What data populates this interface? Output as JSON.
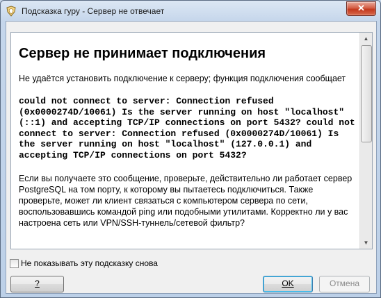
{
  "window": {
    "title": "Подсказка гуру - Сервер не отвечает",
    "close_label": "✕"
  },
  "content": {
    "heading": "Сервер не принимает подключения",
    "intro": "Не удаётся установить подключение к серверу; функция подключения сообщает",
    "error_text": "could not connect to server: Connection refused (0x0000274D/10061) Is the server running on host \"localhost\" (::1) and accepting TCP/IP connections on port 5432? could not connect to server: Connection refused (0x0000274D/10061) Is the server running on host \"localhost\" (127.0.0.1) and accepting TCP/IP connections on port 5432?",
    "advice": "Если вы получаете это сообщение, проверьте, действительно ли работает сервер PostgreSQL на том порту, к которому вы пытаетесь подключиться. Также проверьте, может ли клиент связаться с компьютером сервера по сети, воспользовавшись командой ping или подобными утилитами. Корректно ли у вас настроена сеть или VPN/SSH-туннель/сетевой фильтр?"
  },
  "footer": {
    "dont_show_label": "Не показывать эту подсказку снова",
    "dont_show_checked": false,
    "help_label": "?",
    "ok_label": "OK",
    "cancel_label": "Отмена"
  }
}
